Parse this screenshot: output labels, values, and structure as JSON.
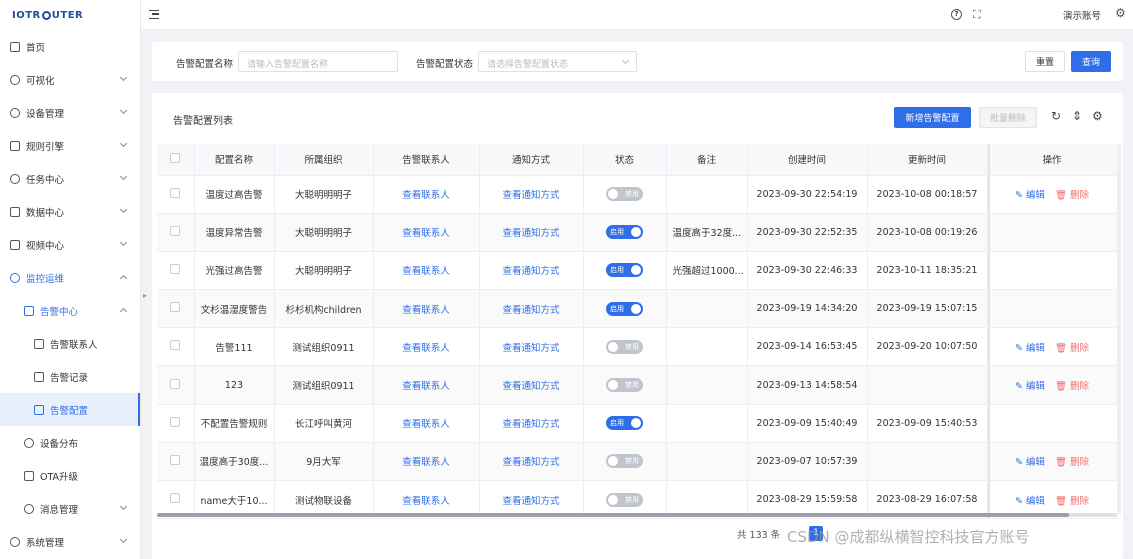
{
  "app": {
    "logo": "IOTROUTER"
  },
  "sidebar": {
    "items": [
      {
        "label": "首页",
        "icon": "home-icon"
      },
      {
        "label": "可视化",
        "icon": "visual-icon",
        "expandable": true
      },
      {
        "label": "设备管理",
        "icon": "device-icon",
        "expandable": true
      },
      {
        "label": "规则引擎",
        "icon": "rule-icon",
        "expandable": true
      },
      {
        "label": "任务中心",
        "icon": "task-icon",
        "expandable": true
      },
      {
        "label": "数据中心",
        "icon": "data-icon",
        "expandable": true
      },
      {
        "label": "视频中心",
        "icon": "video-icon",
        "expandable": true
      },
      {
        "label": "监控运维",
        "icon": "monitor-icon",
        "expandable": true,
        "expanded": true
      },
      {
        "label": "告警中心",
        "icon": "alarm-icon",
        "expandable": true,
        "expanded": true
      },
      {
        "label": "告警联系人",
        "icon": "contact-icon"
      },
      {
        "label": "告警记录",
        "icon": "record-icon"
      },
      {
        "label": "告警配置",
        "icon": "config-icon",
        "active": true
      },
      {
        "label": "设备分布",
        "icon": "location-icon"
      },
      {
        "label": "OTA升级",
        "icon": "ota-icon"
      },
      {
        "label": "消息管理",
        "icon": "message-icon",
        "expandable": true
      },
      {
        "label": "系统管理",
        "icon": "system-icon",
        "expandable": true
      }
    ]
  },
  "topbar": {
    "user": "演示账号"
  },
  "filter": {
    "name_label": "告警配置名称",
    "name_placeholder": "请输入告警配置名称",
    "status_label": "告警配置状态",
    "status_placeholder": "请选择告警配置状态",
    "reset": "重置",
    "query": "查询"
  },
  "list": {
    "title": "告警配置列表",
    "add": "新增告警配置",
    "batch_delete": "批量删除",
    "columns": [
      "配置名称",
      "所属组织",
      "告警联系人",
      "通知方式",
      "状态",
      "备注",
      "创建时间",
      "更新时间",
      "操作"
    ],
    "view_contacts": "查看联系人",
    "view_notify": "查看通知方式",
    "edit": "编辑",
    "delete": "删除",
    "on": "启用",
    "off": "禁用",
    "rows": [
      {
        "name": "温度过高告警",
        "org": "大聪明明明子",
        "status": "off",
        "note": "",
        "created": "2023-09-30 22:54:19",
        "updated": "2023-10-08 00:18:57",
        "ops": true
      },
      {
        "name": "温度异常告警",
        "org": "大聪明明明子",
        "status": "on",
        "note": "温度高于32度...",
        "created": "2023-09-30 22:52:35",
        "updated": "2023-10-08 00:19:26",
        "ops": false
      },
      {
        "name": "光强过高告警",
        "org": "大聪明明明子",
        "status": "on",
        "note": "光强超过1000...",
        "created": "2023-09-30 22:46:33",
        "updated": "2023-10-11 18:35:21",
        "ops": false
      },
      {
        "name": "文杉温湿度警告",
        "org": "杉杉机构children",
        "status": "on",
        "note": "",
        "created": "2023-09-19 14:34:20",
        "updated": "2023-09-19 15:07:15",
        "ops": false
      },
      {
        "name": "告警111",
        "org": "测试组织0911",
        "status": "off",
        "note": "",
        "created": "2023-09-14 16:53:45",
        "updated": "2023-09-20 10:07:50",
        "ops": true
      },
      {
        "name": "123",
        "org": "测试组织0911",
        "status": "off",
        "note": "",
        "created": "2023-09-13 14:58:54",
        "updated": "",
        "ops": true
      },
      {
        "name": "不配置告警规则",
        "org": "长江呼叫黄河",
        "status": "on",
        "note": "",
        "created": "2023-09-09 15:40:49",
        "updated": "2023-09-09 15:40:53",
        "ops": false
      },
      {
        "name": "温度高于30度...",
        "org": "9月大军",
        "status": "off",
        "note": "",
        "created": "2023-09-07 10:57:39",
        "updated": "",
        "ops": true
      },
      {
        "name": "name大于10...",
        "org": "测试物联设备",
        "status": "off",
        "note": "",
        "created": "2023-08-29 15:59:58",
        "updated": "2023-08-29 16:07:58",
        "ops": true
      }
    ]
  },
  "pagination": {
    "total_text": "共 133 条",
    "current_page": "1"
  },
  "watermark": "CSDN @成都纵横智控科技官方账号",
  "colors": {
    "primary": "#2f6ee8",
    "danger": "#f56c6c",
    "switch_off": "#c0c4cc"
  }
}
